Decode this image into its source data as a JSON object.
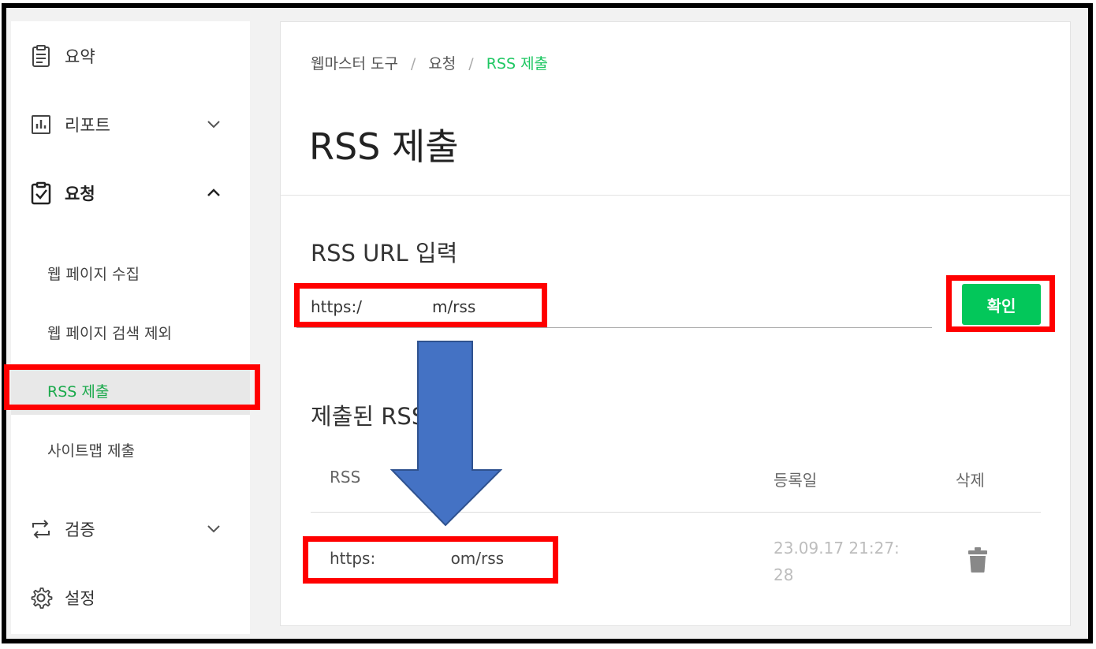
{
  "sidebar": {
    "items": [
      {
        "label": "요약",
        "icon": "clipboard-list-icon"
      },
      {
        "label": "리포트",
        "icon": "bar-chart-icon",
        "expanded": false
      },
      {
        "label": "요청",
        "icon": "clipboard-check-icon",
        "expanded": true
      },
      {
        "label": "검증",
        "icon": "repeat-arrows-icon",
        "expanded": false
      },
      {
        "label": "설정",
        "icon": "gear-icon"
      }
    ],
    "subitems": [
      {
        "label": "웹 페이지 수집"
      },
      {
        "label": "웹 페이지 검색 제외"
      },
      {
        "label": "RSS 제출",
        "active": true
      },
      {
        "label": "사이트맵 제출"
      }
    ]
  },
  "breadcrumb": {
    "items": [
      "웹마스터 도구",
      "요청",
      "RSS 제출"
    ],
    "separator": "/"
  },
  "page_title": "RSS 제출",
  "input_section": {
    "title": "RSS URL 입력",
    "url_value": "https:/              m/rss",
    "confirm_label": "확인"
  },
  "submitted_section": {
    "title": "제출된 RSS",
    "columns": [
      "RSS",
      "등록일",
      "삭제"
    ],
    "rows": [
      {
        "rss": "https:               om/rss",
        "date_line1": "23.09.17 21:27:",
        "date_line2": "28"
      }
    ]
  },
  "colors": {
    "accent_green": "#03c75a",
    "annotation_red": "#ff0000",
    "arrow_blue": "#4472c4"
  }
}
